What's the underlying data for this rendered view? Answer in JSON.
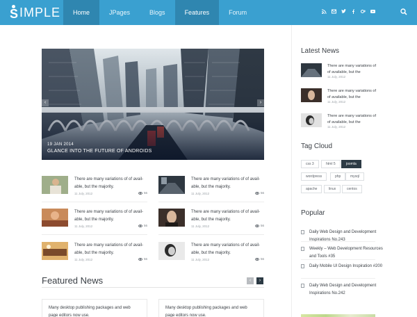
{
  "header": {
    "logo_mark": "S",
    "logo_text": "IMPLE",
    "nav": [
      {
        "label": "Home",
        "state": "active"
      },
      {
        "label": "JPages",
        "state": ""
      },
      {
        "label": "Blogs",
        "state": ""
      },
      {
        "label": "Features",
        "state": "current"
      },
      {
        "label": "Forum",
        "state": ""
      }
    ],
    "social_icons": [
      "rss-icon",
      "mail-icon",
      "twitter-icon",
      "facebook-icon",
      "google-plus-icon",
      "youtube-icon"
    ],
    "accent_color": "#3aa0d0",
    "active_tab_color": "#2f86b0"
  },
  "slider": {
    "date": "19 JAN 2014",
    "title": "GLANCE INTO THE FUTURE OF ANDROIDS",
    "prev_icon": "chevron-left-icon",
    "next_icon": "chevron-right-icon"
  },
  "posts": [
    {
      "excerpt": "There are many variations of of avail-able, but the majority.",
      "date": "11 July, 2012",
      "views": "56"
    },
    {
      "excerpt": "There are many variations of of avail-able, but the majority.",
      "date": "11 July, 2012",
      "views": "56"
    },
    {
      "excerpt": "There are many variations of of avail-able, but the majority.",
      "date": "11 July, 2012",
      "views": "56"
    },
    {
      "excerpt": "There are many variations of of avail-able, but the majority.",
      "date": "11 July, 2012",
      "views": "56"
    },
    {
      "excerpt": "There are many variations of of avail-able, but the majority.",
      "date": "11 July, 2012",
      "views": "56"
    },
    {
      "excerpt": "There are many variations of of avail-able, but the majority.",
      "date": "11 July, 2012",
      "views": "56"
    }
  ],
  "featured": {
    "title": "Featured News",
    "prev": "‹",
    "next": "›",
    "cards": [
      "Many desktop publishing packages and web page editors now use.",
      "Many desktop publishing packages and web page editors now use."
    ]
  },
  "sidebar": {
    "latest_title": "Latest News",
    "latest": [
      {
        "text": "There are many variations of of available, but the",
        "date": "11 July, 2012"
      },
      {
        "text": "There are many variations of of available, but the",
        "date": "11 July, 2012"
      },
      {
        "text": "There are many variations of of available, but the",
        "date": "11 July, 2012"
      }
    ],
    "tag_title": "Tag Cloud",
    "tags": [
      {
        "label": "css 3",
        "active": false
      },
      {
        "label": "html 5",
        "active": false
      },
      {
        "label": "joomla",
        "active": true
      },
      {
        "label": "wordpress",
        "active": false
      },
      {
        "label": "php",
        "active": false
      },
      {
        "label": "mysql",
        "active": false
      },
      {
        "label": "apache",
        "active": false
      },
      {
        "label": "linux",
        "active": false
      },
      {
        "label": "centos",
        "active": false
      }
    ],
    "popular_title": "Popular",
    "popular": [
      "Daily Web Design and Development Inspirations No.243",
      "Weekly – Web Development Resources and Tools #35",
      "Daily Mobile UI Design Inspiration #200",
      "Daily Web Design and Development Inspirations No.242"
    ]
  }
}
